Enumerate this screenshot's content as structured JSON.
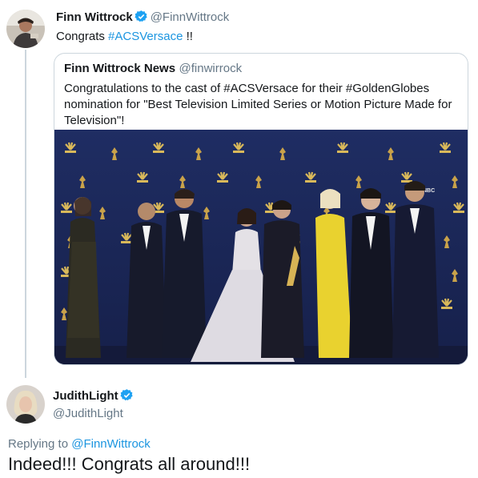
{
  "colors": {
    "link": "#1b95e0",
    "verified": "#1da1f2",
    "muted": "#657786",
    "border": "#ccd6dd"
  },
  "tweet": {
    "author_name": "Finn Wittrock",
    "author_handle": "@FinnWittrock",
    "text_prefix": "Congrats ",
    "hashtag": "#ACSVersace",
    "text_suffix": " !!",
    "verified_icon": "verified-badge-icon"
  },
  "quoted_tweet": {
    "author_name": "Finn Wittrock News",
    "author_handle": "@finwirrock",
    "text": "Congratulations to the cast of #ACSVersace for their #GoldenGlobes nomination for \"Best Television Limited Series or Motion Picture Made for Television\"!",
    "photo_backdrop_logo": "NBC"
  },
  "reply": {
    "author_name": "JudithLight",
    "author_handle": "@JudithLight",
    "replying_prefix": "Replying to ",
    "replying_to": "@FinnWittrock",
    "text": "Indeed!!! Congrats all around!!!"
  }
}
